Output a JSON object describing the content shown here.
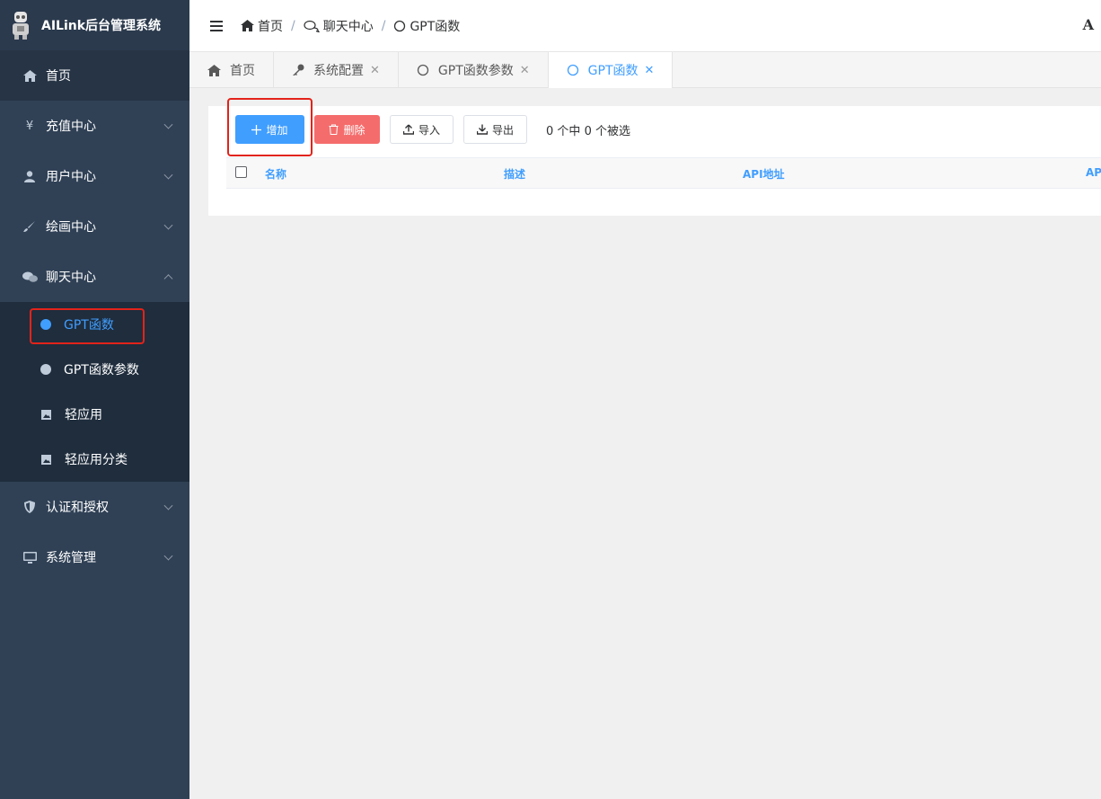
{
  "sidebar": {
    "app_title": "AILink后台管理系统",
    "menu": [
      {
        "label": "首页",
        "icon": "home-icon"
      },
      {
        "label": "充值中心",
        "icon": "yen-icon"
      },
      {
        "label": "用户中心",
        "icon": "user-icon"
      },
      {
        "label": "绘画中心",
        "icon": "brush-icon"
      },
      {
        "label": "聊天中心",
        "icon": "chat-icon"
      }
    ],
    "chat_submenu": [
      {
        "label": "GPT函数",
        "icon": "dot-icon"
      },
      {
        "label": "GPT函数参数",
        "icon": "dot-icon"
      },
      {
        "label": "轻应用",
        "icon": "picture-icon"
      },
      {
        "label": "轻应用分类",
        "icon": "picture-icon"
      }
    ],
    "menu_after": [
      {
        "label": "认证和授权",
        "icon": "shield-icon"
      },
      {
        "label": "系统管理",
        "icon": "monitor-icon"
      }
    ]
  },
  "navbar": {
    "breadcrumb": [
      {
        "label": "首页",
        "icon": "home-icon"
      },
      {
        "label": "聊天中心",
        "icon": "chat-icon"
      },
      {
        "label": "GPT函数",
        "icon": "circle-icon"
      }
    ],
    "separator": "/",
    "right_char": "A"
  },
  "tags": [
    {
      "label": "首页",
      "icon": "home-icon",
      "closable": false
    },
    {
      "label": "系统配置",
      "icon": "key-icon",
      "closable": true
    },
    {
      "label": "GPT函数参数",
      "icon": "circle-icon",
      "closable": true
    },
    {
      "label": "GPT函数",
      "icon": "circle-icon",
      "closable": true
    }
  ],
  "toolbar": {
    "add_label": "增加",
    "delete_label": "删除",
    "import_label": "导入",
    "export_label": "导出",
    "selection_info": "0 个中 0 个被选"
  },
  "table": {
    "headers": [
      "名称",
      "描述",
      "API地址",
      "AP"
    ]
  },
  "colors": {
    "sidebar_bg": "#304156",
    "accent": "#409eff",
    "danger": "#f56c6c",
    "highlight": "#e2231a"
  }
}
